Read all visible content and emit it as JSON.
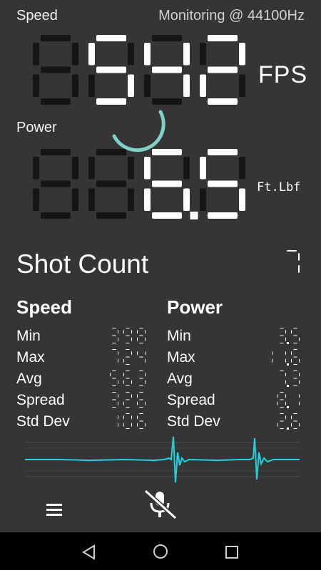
{
  "header": {
    "speed_label": "Speed",
    "monitoring_text": "Monitoring @ 44100Hz",
    "power_label": "Power"
  },
  "speed_display": {
    "value": "542",
    "unit": "FPS"
  },
  "power_display": {
    "value": "6.5",
    "unit": "Ft.Lbf"
  },
  "shot_count": {
    "label": "Shot Count",
    "value": "7"
  },
  "stats": {
    "speed": {
      "title": "Speed",
      "rows": [
        {
          "name": "Min",
          "value": "398"
        },
        {
          "name": "Max",
          "value": "724"
        },
        {
          "name": "Avg",
          "value": "563"
        },
        {
          "name": "Spread",
          "value": "326"
        },
        {
          "name": "Std Dev",
          "value": "106"
        }
      ]
    },
    "power": {
      "title": "Power",
      "rows": [
        {
          "name": "Min",
          "value": "3.5"
        },
        {
          "name": "Max",
          "value": "11.6"
        },
        {
          "name": "Avg",
          "value": "7.3"
        },
        {
          "name": "Spread",
          "value": "8.1"
        },
        {
          "name": "Std Dev",
          "value": "2.6"
        }
      ]
    }
  },
  "toolbar": {
    "menu_icon": "menu-icon",
    "mic_icon": "mic-off-icon"
  },
  "nav": {
    "back_icon": "back-triangle-icon",
    "home_icon": "home-circle-icon",
    "recents_icon": "recents-square-icon"
  },
  "colors": {
    "background": "#353535",
    "accent": "#7fd0c8",
    "waveform": "#1fd3e0",
    "segment_off": "#151515",
    "segment_on": "#ffffff"
  }
}
